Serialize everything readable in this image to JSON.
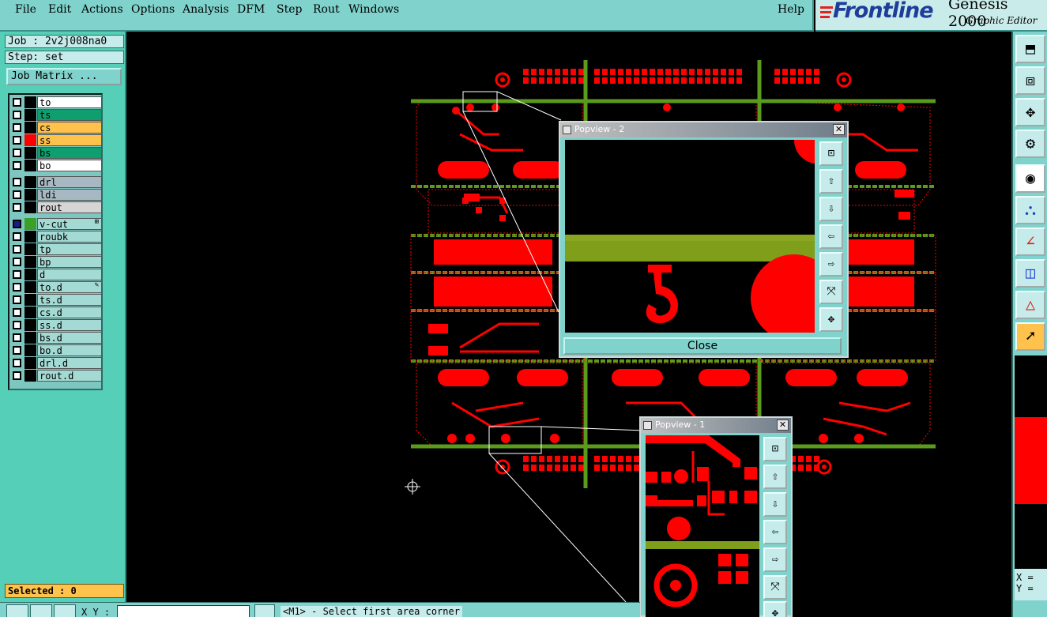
{
  "menu": {
    "items": [
      "File",
      "Edit",
      "Actions",
      "Options",
      "Analysis",
      "DFM",
      "Step",
      "Rout",
      "Windows"
    ],
    "help": "Help"
  },
  "brand": {
    "logo": "Frontline",
    "product": "Genesis 2000",
    "subtitle": "Graphic Editor"
  },
  "job": {
    "job_label": "Job : 2v2j008na0",
    "step_label": "Step: set",
    "matrix_button": "Job Matrix ..."
  },
  "layers": [
    {
      "name": "to",
      "color": "#ffffff",
      "swatch": "#000000"
    },
    {
      "name": "ts",
      "color": "#0f9e6e",
      "swatch": "#000000"
    },
    {
      "name": "cs",
      "color": "#ffc24d",
      "swatch": "#000000"
    },
    {
      "name": "ss",
      "color": "#ffc24d",
      "swatch": "#ff0000"
    },
    {
      "name": "bs",
      "color": "#0f9e6e",
      "swatch": "#000000"
    },
    {
      "name": "bo",
      "color": "#ffffff",
      "swatch": "#000000"
    },
    {
      "name": "drl",
      "color": "#a8b8c2",
      "swatch": "#000000"
    },
    {
      "name": "ldi",
      "color": "#a8b8c2",
      "swatch": "#000000"
    },
    {
      "name": "rout",
      "color": "#d5d5d5",
      "swatch": "#000000"
    },
    {
      "name": "v-cut",
      "color": "#a4dad4",
      "swatch": "#3aa028",
      "mark": "⊞",
      "checked": true
    },
    {
      "name": "roubk",
      "color": "#a4dad4",
      "swatch": "#000000"
    },
    {
      "name": "tp",
      "color": "#a4dad4",
      "swatch": "#000000"
    },
    {
      "name": "bp",
      "color": "#a4dad4",
      "swatch": "#000000"
    },
    {
      "name": "d",
      "color": "#a4dad4",
      "swatch": "#000000"
    },
    {
      "name": "to.d",
      "color": "#a4dad4",
      "swatch": "#000000",
      "mark": "✎"
    },
    {
      "name": "ts.d",
      "color": "#a4dad4",
      "swatch": "#000000"
    },
    {
      "name": "cs.d",
      "color": "#a4dad4",
      "swatch": "#000000"
    },
    {
      "name": "ss.d",
      "color": "#a4dad4",
      "swatch": "#000000"
    },
    {
      "name": "bs.d",
      "color": "#a4dad4",
      "swatch": "#000000"
    },
    {
      "name": "bo.d",
      "color": "#a4dad4",
      "swatch": "#000000"
    },
    {
      "name": "drl.d",
      "color": "#a4dad4",
      "swatch": "#000000"
    },
    {
      "name": "rout.d",
      "color": "#a4dad4",
      "swatch": "#000000"
    }
  ],
  "selected": "Selected : 0",
  "bottom": {
    "xy_label": "X Y :",
    "status": "<M1> - Select first area corner"
  },
  "coords": {
    "x_label": "X = ",
    "y_label": "Y = "
  },
  "popview2": {
    "title": "Popview - 2",
    "close_label": "Close"
  },
  "popview1": {
    "title": "Popview - 1"
  },
  "colors": {
    "copper": "#ff0000",
    "vcut": "#5a9b1c",
    "panel_bg": "#55cfb7",
    "menu_bg": "#7fd3cc"
  },
  "icons": {
    "toolbar_right": [
      "zoom-home-icon",
      "zoom-window-icon",
      "zoom-fit-icon",
      "measure-icon",
      "snap-icon",
      "net-icon",
      "route-icon",
      "dfm-icon",
      "drc-icon",
      "pointer-icon"
    ]
  }
}
